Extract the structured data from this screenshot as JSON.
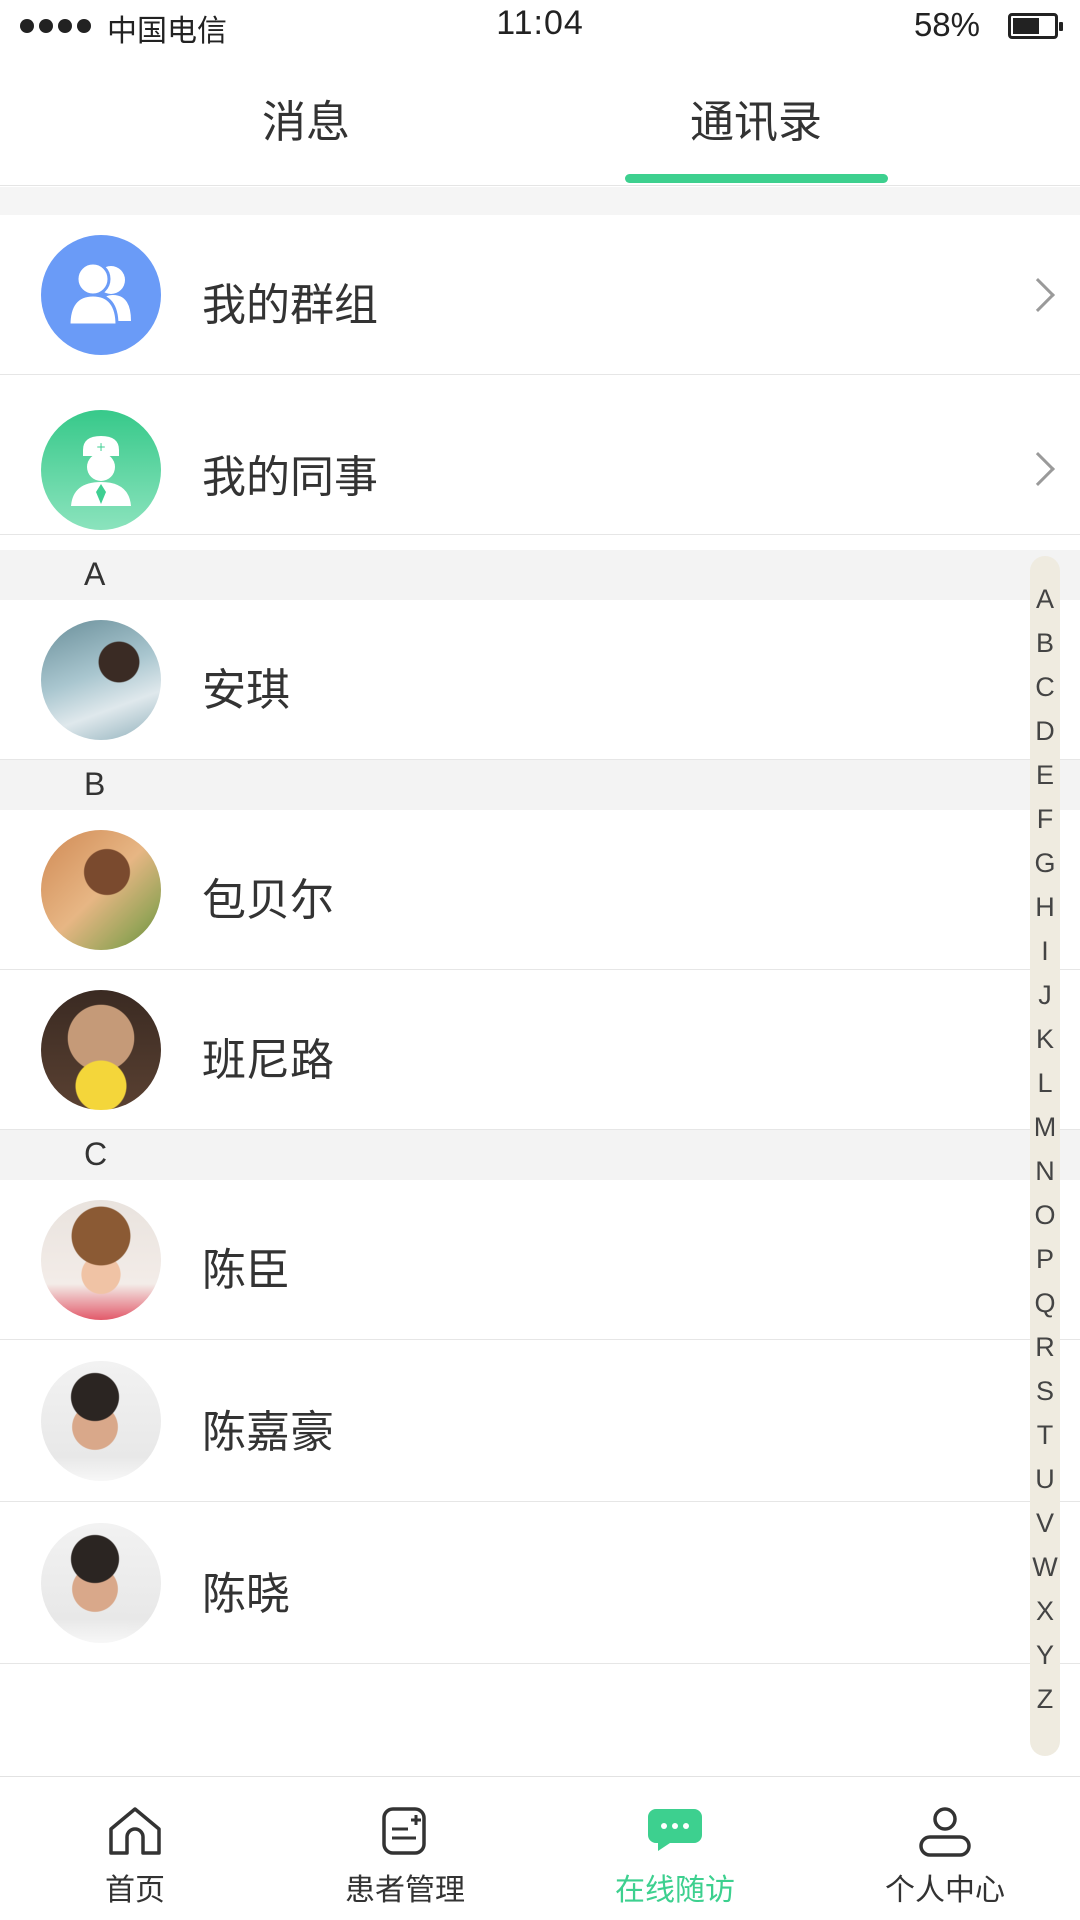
{
  "status_bar": {
    "carrier": "中国电信",
    "time": "11:04",
    "battery_percent": "58%",
    "battery_level": 0.58
  },
  "tabs": [
    {
      "label": "消息",
      "active": false
    },
    {
      "label": "通讯录",
      "active": true
    }
  ],
  "accent_color": "#3dd08f",
  "quick_entries": [
    {
      "label": "我的群组",
      "icon": "group-icon",
      "color": "#6a9bf7"
    },
    {
      "label": "我的同事",
      "icon": "doctor-icon",
      "color": "#3fcf92"
    }
  ],
  "sections": [
    {
      "letter": "A",
      "contacts": [
        {
          "name": "安琪"
        }
      ]
    },
    {
      "letter": "B",
      "contacts": [
        {
          "name": "包贝尔"
        },
        {
          "name": "班尼路"
        }
      ]
    },
    {
      "letter": "C",
      "contacts": [
        {
          "name": "陈臣"
        },
        {
          "name": "陈嘉豪"
        },
        {
          "name": "陈晓"
        }
      ]
    }
  ],
  "alphabet_index": [
    "A",
    "B",
    "C",
    "D",
    "E",
    "F",
    "G",
    "H",
    "I",
    "J",
    "K",
    "L",
    "M",
    "N",
    "O",
    "P",
    "Q",
    "R",
    "S",
    "T",
    "U",
    "V",
    "W",
    "X",
    "Y",
    "Z"
  ],
  "bottom_nav": [
    {
      "label": "首页",
      "icon": "home-icon",
      "active": false
    },
    {
      "label": "患者管理",
      "icon": "patient-list-icon",
      "active": false
    },
    {
      "label": "在线随访",
      "icon": "chat-bubble-icon",
      "active": true
    },
    {
      "label": "个人中心",
      "icon": "person-icon",
      "active": false
    }
  ]
}
